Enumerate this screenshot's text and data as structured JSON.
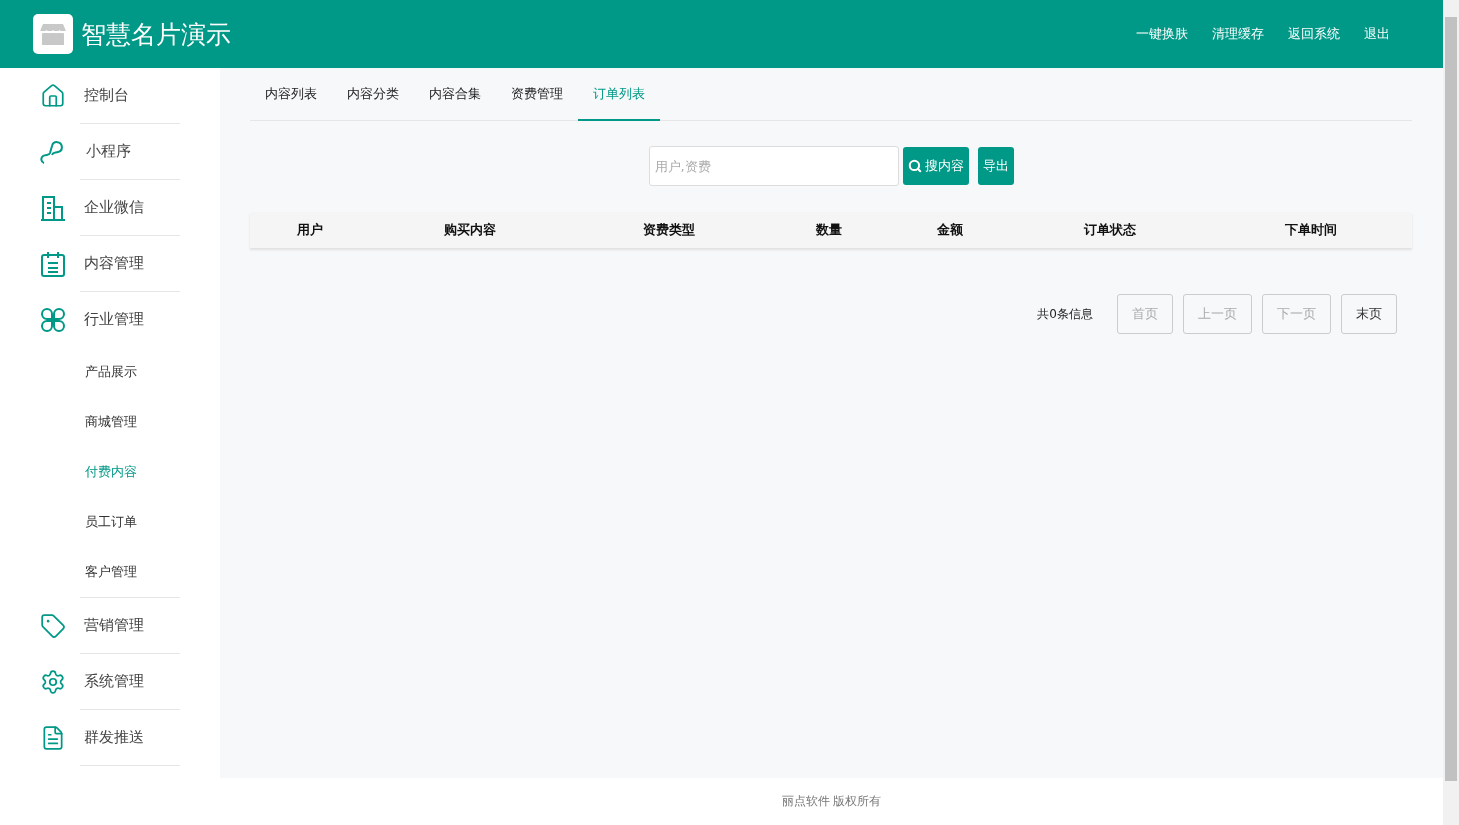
{
  "header": {
    "title": "智慧名片演示",
    "links": [
      "一键换肤",
      "清理缓存",
      "返回系统",
      "退出"
    ]
  },
  "sidebar": {
    "items": [
      {
        "label": "控制台",
        "selected": false
      },
      {
        "label": "小程序",
        "selected": false
      },
      {
        "label": "企业微信",
        "selected": false
      },
      {
        "label": "内容管理",
        "selected": false
      },
      {
        "label": "行业管理",
        "selected": false,
        "children": [
          {
            "label": "产品展示",
            "selected": false
          },
          {
            "label": "商城管理",
            "selected": false
          },
          {
            "label": "付费内容",
            "selected": true
          },
          {
            "label": "员工订单",
            "selected": false
          },
          {
            "label": "客户管理",
            "selected": false
          }
        ]
      },
      {
        "label": "营销管理",
        "selected": false
      },
      {
        "label": "系统管理",
        "selected": false
      },
      {
        "label": "群发推送",
        "selected": false
      }
    ]
  },
  "tabs": [
    {
      "label": "内容列表",
      "selected": false
    },
    {
      "label": "内容分类",
      "selected": false
    },
    {
      "label": "内容合集",
      "selected": false
    },
    {
      "label": "资费管理",
      "selected": false
    },
    {
      "label": "订单列表",
      "selected": true
    }
  ],
  "search": {
    "placeholder": "用户,资费",
    "search_button": "搜内容",
    "export_button": "导出"
  },
  "table": {
    "columns": [
      "用户",
      "购买内容",
      "资费类型",
      "数量",
      "金额",
      "订单状态",
      "下单时间"
    ]
  },
  "pagination": {
    "summary": "共0条信息",
    "buttons": [
      {
        "label": "首页",
        "disabled": true
      },
      {
        "label": "上一页",
        "disabled": true
      },
      {
        "label": "下一页",
        "disabled": true
      },
      {
        "label": "末页",
        "disabled": false
      }
    ]
  },
  "footer": "丽点软件 版权所有"
}
